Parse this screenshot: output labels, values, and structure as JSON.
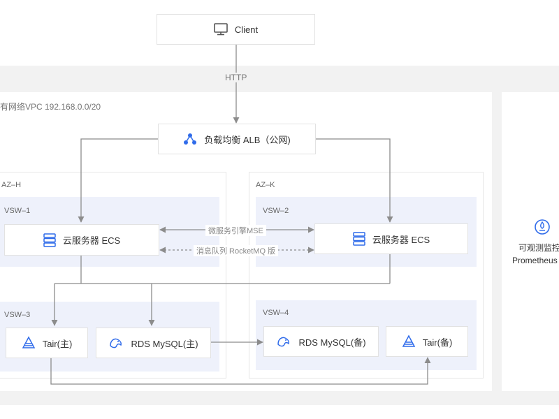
{
  "client": {
    "label": "Client",
    "icon": "monitor-icon"
  },
  "http_label": "HTTP",
  "vpc": {
    "label": "有网络VPC 192.168.0.0/20"
  },
  "alb": {
    "label": "负载均衡 ALB（公网)",
    "icon": "load-balancer-icon"
  },
  "az_h": {
    "label": "AZ–H",
    "vsw1": {
      "label": "VSW–1",
      "ecs": {
        "label": "云服务器 ECS",
        "icon": "server-icon"
      }
    },
    "vsw3": {
      "label": "VSW–3",
      "tair": {
        "label": "Tair(主)",
        "icon": "tair-icon"
      },
      "rds": {
        "label": "RDS MySQL(主)",
        "icon": "rds-mysql-icon"
      }
    }
  },
  "az_k": {
    "label": "AZ–K",
    "vsw2": {
      "label": "VSW–2",
      "ecs": {
        "label": "云服务器 ECS",
        "icon": "server-icon"
      }
    },
    "vsw4": {
      "label": "VSW–4",
      "rds": {
        "label": "RDS MySQL(备)",
        "icon": "rds-mysql-icon"
      },
      "tair": {
        "label": "Tair(备)",
        "icon": "tair-icon"
      }
    }
  },
  "links": {
    "mse": "微服务引擎MSE",
    "mq": "消息队列 RocketMQ 版"
  },
  "observability": {
    "label": "可观测监控",
    "sub": "Prometheus",
    "icon": "prometheus-icon"
  },
  "colors": {
    "accent": "#2f6bea",
    "line": "#8c8c8c",
    "vsw_fill": "#eef1fb",
    "region_fill": "#f2f2f2"
  }
}
